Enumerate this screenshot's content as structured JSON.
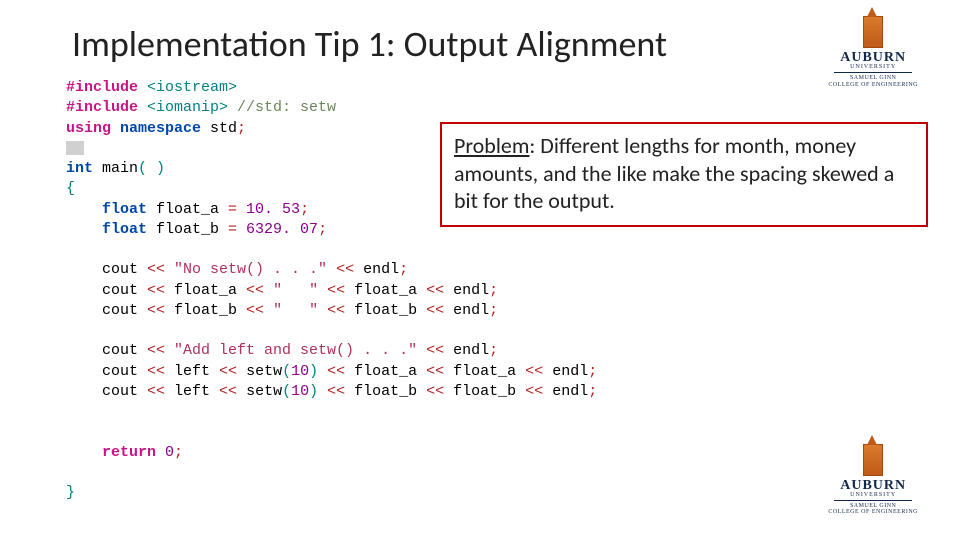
{
  "title": "Implementation Tip 1: Output Alignment",
  "problem": {
    "label": "Problem",
    "colon": ": ",
    "text": "Different lengths for month, money amounts, and the like make the spacing skewed a bit for the output."
  },
  "code": {
    "l1a": "#include",
    "l1b": " <iostream>",
    "l2a": "#include",
    "l2b": " <iomanip> ",
    "l2c": "//std: setw",
    "l3a": "using",
    "l3b": " namespace",
    "l3c": " std",
    "l3d": ";",
    "l5a": "int",
    "l5b": " main",
    "l5c": "( )",
    "l6": "{",
    "l7a": "    float",
    "l7b": " float_a ",
    "l7c": "=",
    "l7d": " 10. 53",
    "l7e": ";",
    "l8a": "    float",
    "l8b": " float_b ",
    "l8c": "=",
    "l8d": " 6329. 07",
    "l8e": ";",
    "l10a": "    cout ",
    "l10b": "<<",
    "l10c": " \"No setw() . . .\" ",
    "l10d": "<<",
    "l10e": " endl",
    "l10f": ";",
    "l11a": "    cout ",
    "l11b": "<<",
    "l11c": " float_a ",
    "l11d": "<<",
    "l11e": " \"   \" ",
    "l11f": "<<",
    "l11g": " float_a ",
    "l11h": "<<",
    "l11i": " endl",
    "l11j": ";",
    "l12a": "    cout ",
    "l12b": "<<",
    "l12c": " float_b ",
    "l12d": "<<",
    "l12e": " \"   \" ",
    "l12f": "<<",
    "l12g": " float_b ",
    "l12h": "<<",
    "l12i": " endl",
    "l12j": ";",
    "l14a": "    cout ",
    "l14b": "<<",
    "l14c": " \"Add left and setw() . . .\" ",
    "l14d": "<<",
    "l14e": " endl",
    "l14f": ";",
    "l15a": "    cout ",
    "l15b": "<<",
    "l15c": " left ",
    "l15d": "<<",
    "l15e": " setw",
    "l15f": "(",
    "l15g": "10",
    "l15h": ")",
    "l15i": " <<",
    "l15j": " float_a ",
    "l15k": "<<",
    "l15l": " float_a ",
    "l15m": "<<",
    "l15n": " endl",
    "l15o": ";",
    "l16a": "    cout ",
    "l16b": "<<",
    "l16c": " left ",
    "l16d": "<<",
    "l16e": " setw",
    "l16f": "(",
    "l16g": "10",
    "l16h": ")",
    "l16i": " <<",
    "l16j": " float_b ",
    "l16k": "<<",
    "l16l": " float_b ",
    "l16m": "<<",
    "l16n": " endl",
    "l16o": ";",
    "l19a": "    return",
    "l19b": " 0",
    "l19c": ";",
    "l21": "}"
  },
  "logo": {
    "name": "AUBURN",
    "sub": "UNIVERSITY",
    "ginn1": "SAMUEL GINN",
    "ginn2": "COLLEGE OF ENGINEERING"
  }
}
